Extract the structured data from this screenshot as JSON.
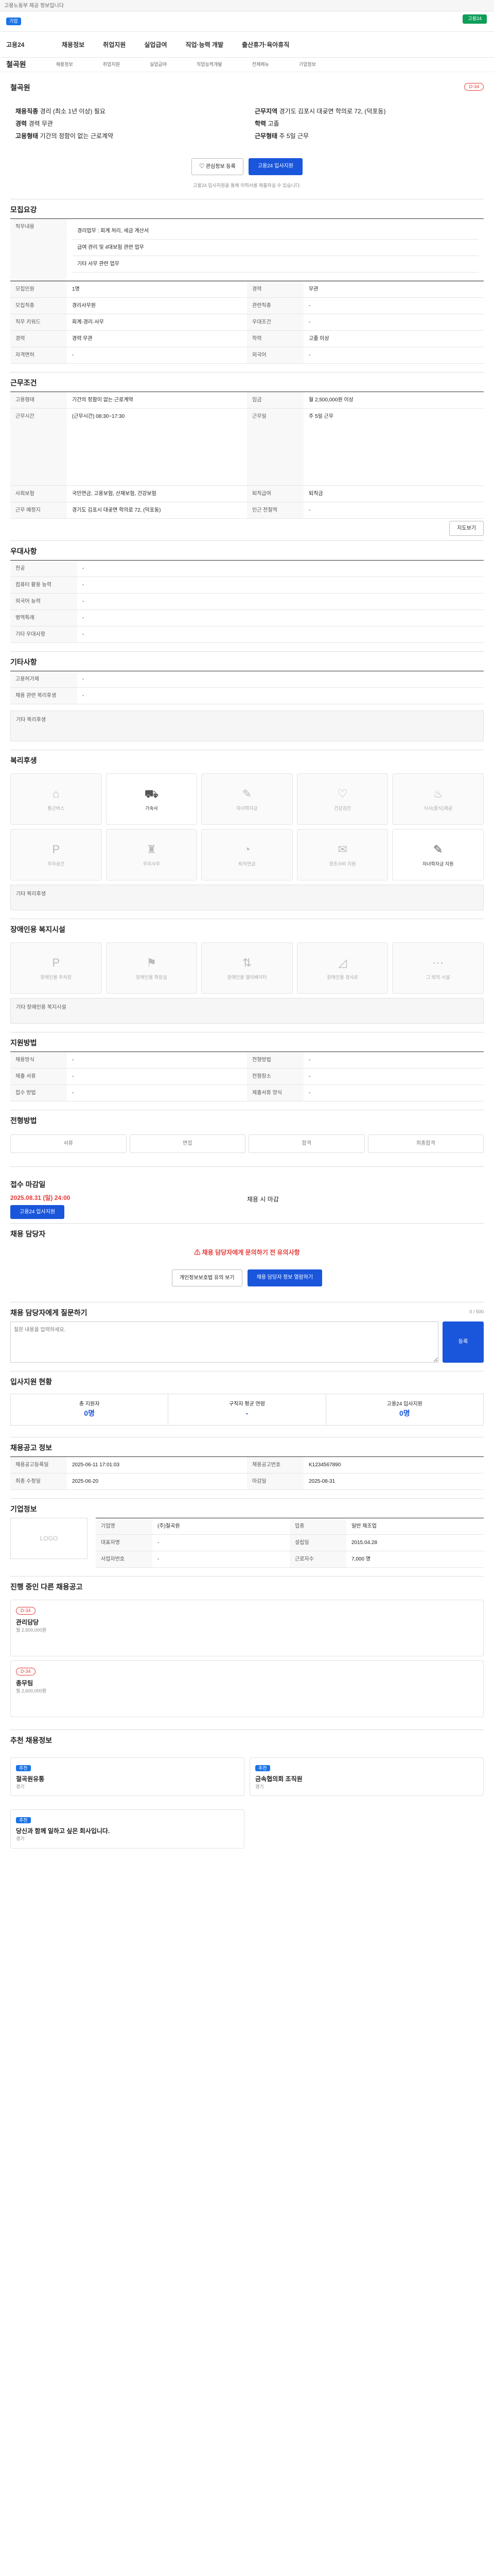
{
  "top": {
    "notice": "고용노동부 제공 정보입니다",
    "search_tag": "기업",
    "green_btn": "고용24"
  },
  "gnb": {
    "logo": "고용24",
    "items": [
      "채용정보",
      "취업지원",
      "실업급여",
      "직업·능력 개발",
      "출산휴가·육아휴직"
    ]
  },
  "sub": {
    "home": "철곡원",
    "items": [
      "채용정보",
      "취업지원",
      "실업급여",
      "직업능력개발",
      "전체메뉴",
      "기업정보"
    ]
  },
  "company": {
    "name": "철곡원",
    "badge": "D-34",
    "rows": [
      [
        "채용직종",
        "경리 (최소 1년 이상) 필요"
      ],
      [
        "근무지역",
        "경기도 김포시 대곶면 학의로 72, (덕포동)"
      ],
      [
        "경력",
        "경력 무관"
      ],
      [
        "학력",
        "고졸"
      ],
      [
        "고용형태",
        "기간의 정함이 없는 근로계약"
      ],
      [
        "근무형태",
        "주 5일 근무"
      ]
    ],
    "like_btn": "관심정보 등록",
    "apply_btn": "고용24 입사지원",
    "notice": "고용24 입사지원을 통해 이력서를 제출하실 수 있습니다."
  },
  "rec": {
    "title": "모집요강",
    "desc": [
      "직무내용",
      "경리업무 : 회계 처리, 세금 계산서",
      "급여 관리 및 4대보험 관련 업무",
      "기타 사무 관련 업무"
    ],
    "rows": [
      [
        "모집인원",
        "1명",
        "경력",
        "무관"
      ],
      [
        "모집직종",
        "경리사무원",
        "관련직종",
        "-"
      ],
      [
        "직무 키워드",
        "회계·경리·사무",
        "우대조건",
        "-"
      ],
      [
        "경력",
        "경력 무관",
        "학력",
        "고졸 이상"
      ],
      [
        "자격면허",
        "-",
        "외국어",
        "-"
      ]
    ]
  },
  "work": {
    "title": "근무조건",
    "rows": [
      [
        "고용형태",
        "기간의 정함이 없는 근로계약",
        "임금",
        "월 2,500,000원 이상"
      ],
      [
        "근무시간",
        "(근무시간) 08:30~17:30",
        "근무일",
        "주 5일 근무"
      ],
      [
        "사회보험",
        "국민연금, 고용보험, 산재보험, 건강보험",
        "퇴직급여",
        "퇴직금"
      ],
      [
        "근무 예정지",
        "경기도 김포시 대곶면 학의로 72, (덕포동)",
        "인근 전철역",
        "-"
      ]
    ],
    "map_btn": "지도보기"
  },
  "pref": {
    "title": "우대사항",
    "rows": [
      [
        "전공",
        "-"
      ],
      [
        "컴퓨터 활용 능력",
        "-"
      ],
      [
        "외국어 능력",
        "-"
      ],
      [
        "병역특례",
        "-"
      ],
      [
        "기타 우대사항",
        "-"
      ]
    ]
  },
  "etc": {
    "title": "기타사항",
    "rows": [
      [
        "고용허가제",
        "-"
      ],
      [
        "채용 관련 복리후생",
        "-"
      ]
    ],
    "extra": "기타 복리후생"
  },
  "welfare": {
    "title": "복리후생",
    "items": [
      "통근버스",
      "기숙사",
      "자녀학자금",
      "건강검진",
      "식사(중식)제공",
      "주차공간",
      "우리사주",
      "퇴직연금",
      "경조사비 지원",
      "자녀학자금 지원"
    ],
    "on": [
      1,
      9
    ],
    "note": "기타 복리후생"
  },
  "disabled": {
    "title": "장애인용 복지시설",
    "items": [
      "장애인용 주차장",
      "장애인용 화장실",
      "장애인용 엘리베이터",
      "장애인용 경사로",
      "그 밖의 시설"
    ],
    "note": "기타 장애인용 복지시설"
  },
  "apply": {
    "title": "지원방법",
    "rows": [
      [
        "채용방식",
        "-",
        "전형방법",
        "-"
      ],
      [
        "제출 서류",
        "-",
        "전형장소",
        "-"
      ],
      [
        "접수 방법",
        "-",
        "제출서류 양식",
        "-"
      ]
    ]
  },
  "process": {
    "title": "전형방법",
    "steps": [
      "서류",
      "면접",
      "합격",
      "최종합격"
    ]
  },
  "deadline": {
    "title": "접수 마감일",
    "date": "2025.08.31 (일) 24:00",
    "status": "채용 시 마감",
    "btn": "고용24 입사지원"
  },
  "contact": {
    "title": "채용 담당자",
    "warn": "채용 담당자에게 문의하기 전 유의사항",
    "btns": [
      "개인정보보호법 유의 보기",
      "채용 담당자 정보 열람하기"
    ]
  },
  "comment": {
    "title": "채용 담당자에게 질문하기",
    "placeholder": "질문 내용을 입력하세요.",
    "btn": "등록",
    "counter": "0 / 500"
  },
  "stats": {
    "title": "입사지원 현황",
    "items": [
      [
        "총 지원자",
        "0명"
      ],
      [
        "구직자 평균 연령",
        "-"
      ],
      [
        "고용24 입사지원",
        "0명"
      ]
    ]
  },
  "info": {
    "title": "채용공고 정보",
    "rows": [
      [
        "채용공고등록일",
        "2025-06-11 17:01:03",
        "채용공고번호",
        "K1234567890"
      ],
      [
        "최종 수정일",
        "2025-06-20",
        "마감일",
        "2025-08-31"
      ]
    ]
  },
  "corp": {
    "title": "기업정보",
    "rows": [
      [
        "기업명",
        "(주)철곡원",
        "업종",
        "일반 제조업"
      ],
      [
        "대표자명",
        "-",
        "설립일",
        "2015.04.28"
      ],
      [
        "사업자번호",
        "-",
        "근로자수",
        "7,000 명"
      ]
    ]
  },
  "related": {
    "title": "진행 중인 다른 채용공고",
    "items": [
      {
        "d": "D-34",
        "name": "관리담당",
        "pay": "월 2,500,000원"
      },
      {
        "d": "D-34",
        "name": "총무팀",
        "pay": "월 2,600,000원"
      }
    ]
  },
  "recommend": {
    "title": "추천 채용정보",
    "items": [
      {
        "tag": "추천",
        "name": "철곡원유통",
        "loc": "경기"
      },
      {
        "tag": "추천",
        "name": "금속협의회 조직원",
        "loc": "경기"
      },
      {
        "tag": "추천",
        "name": "당신과 함께 일하고 싶은 회사입니다.",
        "loc": "경기"
      }
    ]
  }
}
